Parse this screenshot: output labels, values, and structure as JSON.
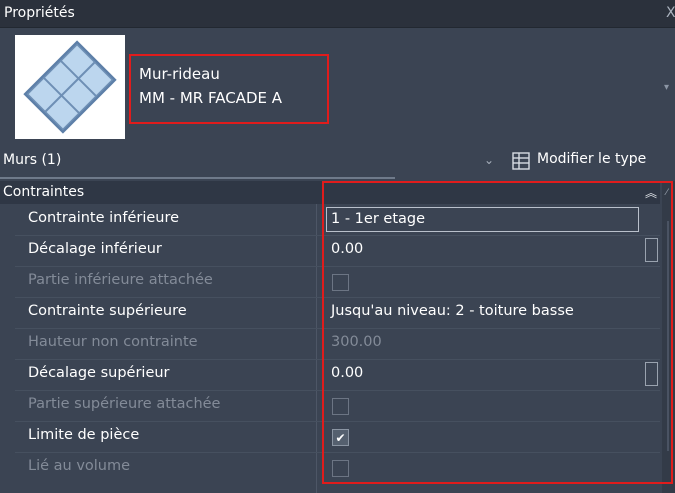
{
  "panel": {
    "title": "Propriétés",
    "close_glyph": "X"
  },
  "type_selector": {
    "family": "Mur-rideau",
    "type": "MM - MR FACADE A",
    "thumbnail_icon": "curtain-wall-icon"
  },
  "filter": {
    "selection": "Murs (1)",
    "edit_type_label": "Modifier le type"
  },
  "category": {
    "label": "Contraintes",
    "collapse_glyph": "⌃"
  },
  "properties": [
    {
      "name": "Contrainte inférieure",
      "value": "1 - 1er etage",
      "state": "editing",
      "control": "text"
    },
    {
      "name": "Décalage inférieur",
      "value": "0.00",
      "state": "enabled",
      "control": "text-button"
    },
    {
      "name": "Partie inférieure attachée",
      "value": "",
      "state": "disabled",
      "control": "checkbox",
      "checked": false
    },
    {
      "name": "Contrainte supérieure",
      "value": "Jusqu'au niveau: 2 - toiture basse",
      "state": "enabled",
      "control": "text"
    },
    {
      "name": "Hauteur non contrainte",
      "value": "300.00",
      "state": "disabled",
      "control": "text"
    },
    {
      "name": "Décalage supérieur",
      "value": "0.00",
      "state": "enabled",
      "control": "text-button"
    },
    {
      "name": "Partie supérieure attachée",
      "value": "",
      "state": "disabled",
      "control": "checkbox",
      "checked": false
    },
    {
      "name": "Limite de pièce",
      "value": "",
      "state": "enabled",
      "control": "checkbox",
      "checked": true
    },
    {
      "name": "Lié au volume",
      "value": "",
      "state": "disabled",
      "control": "checkbox",
      "checked": false
    }
  ],
  "colors": {
    "panel_bg": "#3b4453",
    "highlight_red": "#e01c1c",
    "disabled_text": "#838b98"
  }
}
